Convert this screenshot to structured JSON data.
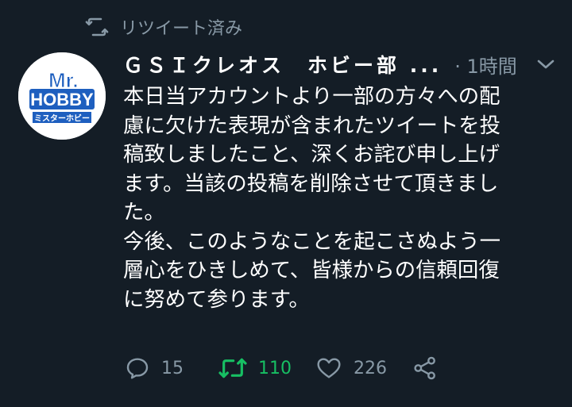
{
  "retweet_header": {
    "label": "リツイート済み",
    "icon": "retweet-icon"
  },
  "tweet": {
    "avatar_icon": "mr-hobby-logo",
    "avatar_text_main": "HOBBY",
    "avatar_text_top": "Mr.",
    "avatar_text_sub": "ミスターホビー",
    "display_name": "ＧＳＩクレオス　ホビー部 ...",
    "time": "· 1時間",
    "menu_icon": "chevron-down-icon",
    "text_lines": [
      "本日当アカウントより一部の方々への配",
      "慮に欠けた表現が含まれたツイートを投",
      "稿致しましたこと、深くお詫び申し上げ",
      "ます。当該の投稿を削除させて頂きまし",
      "た。",
      "今後、このようなことを起こさぬよう一",
      "層心をひきしめて、皆様からの信頼回復",
      "に努めて参ります。"
    ]
  },
  "actions": {
    "reply": {
      "icon": "reply-icon",
      "count": "15"
    },
    "retweet": {
      "icon": "retweet-icon",
      "count": "110",
      "active": true
    },
    "like": {
      "icon": "heart-icon",
      "count": "226"
    },
    "share": {
      "icon": "share-icon"
    }
  },
  "colors": {
    "background": "#141d26",
    "muted": "#8899a6",
    "text": "#ffffff",
    "retweet_active": "#17bf63",
    "logo_blue": "#1e5fbf"
  }
}
